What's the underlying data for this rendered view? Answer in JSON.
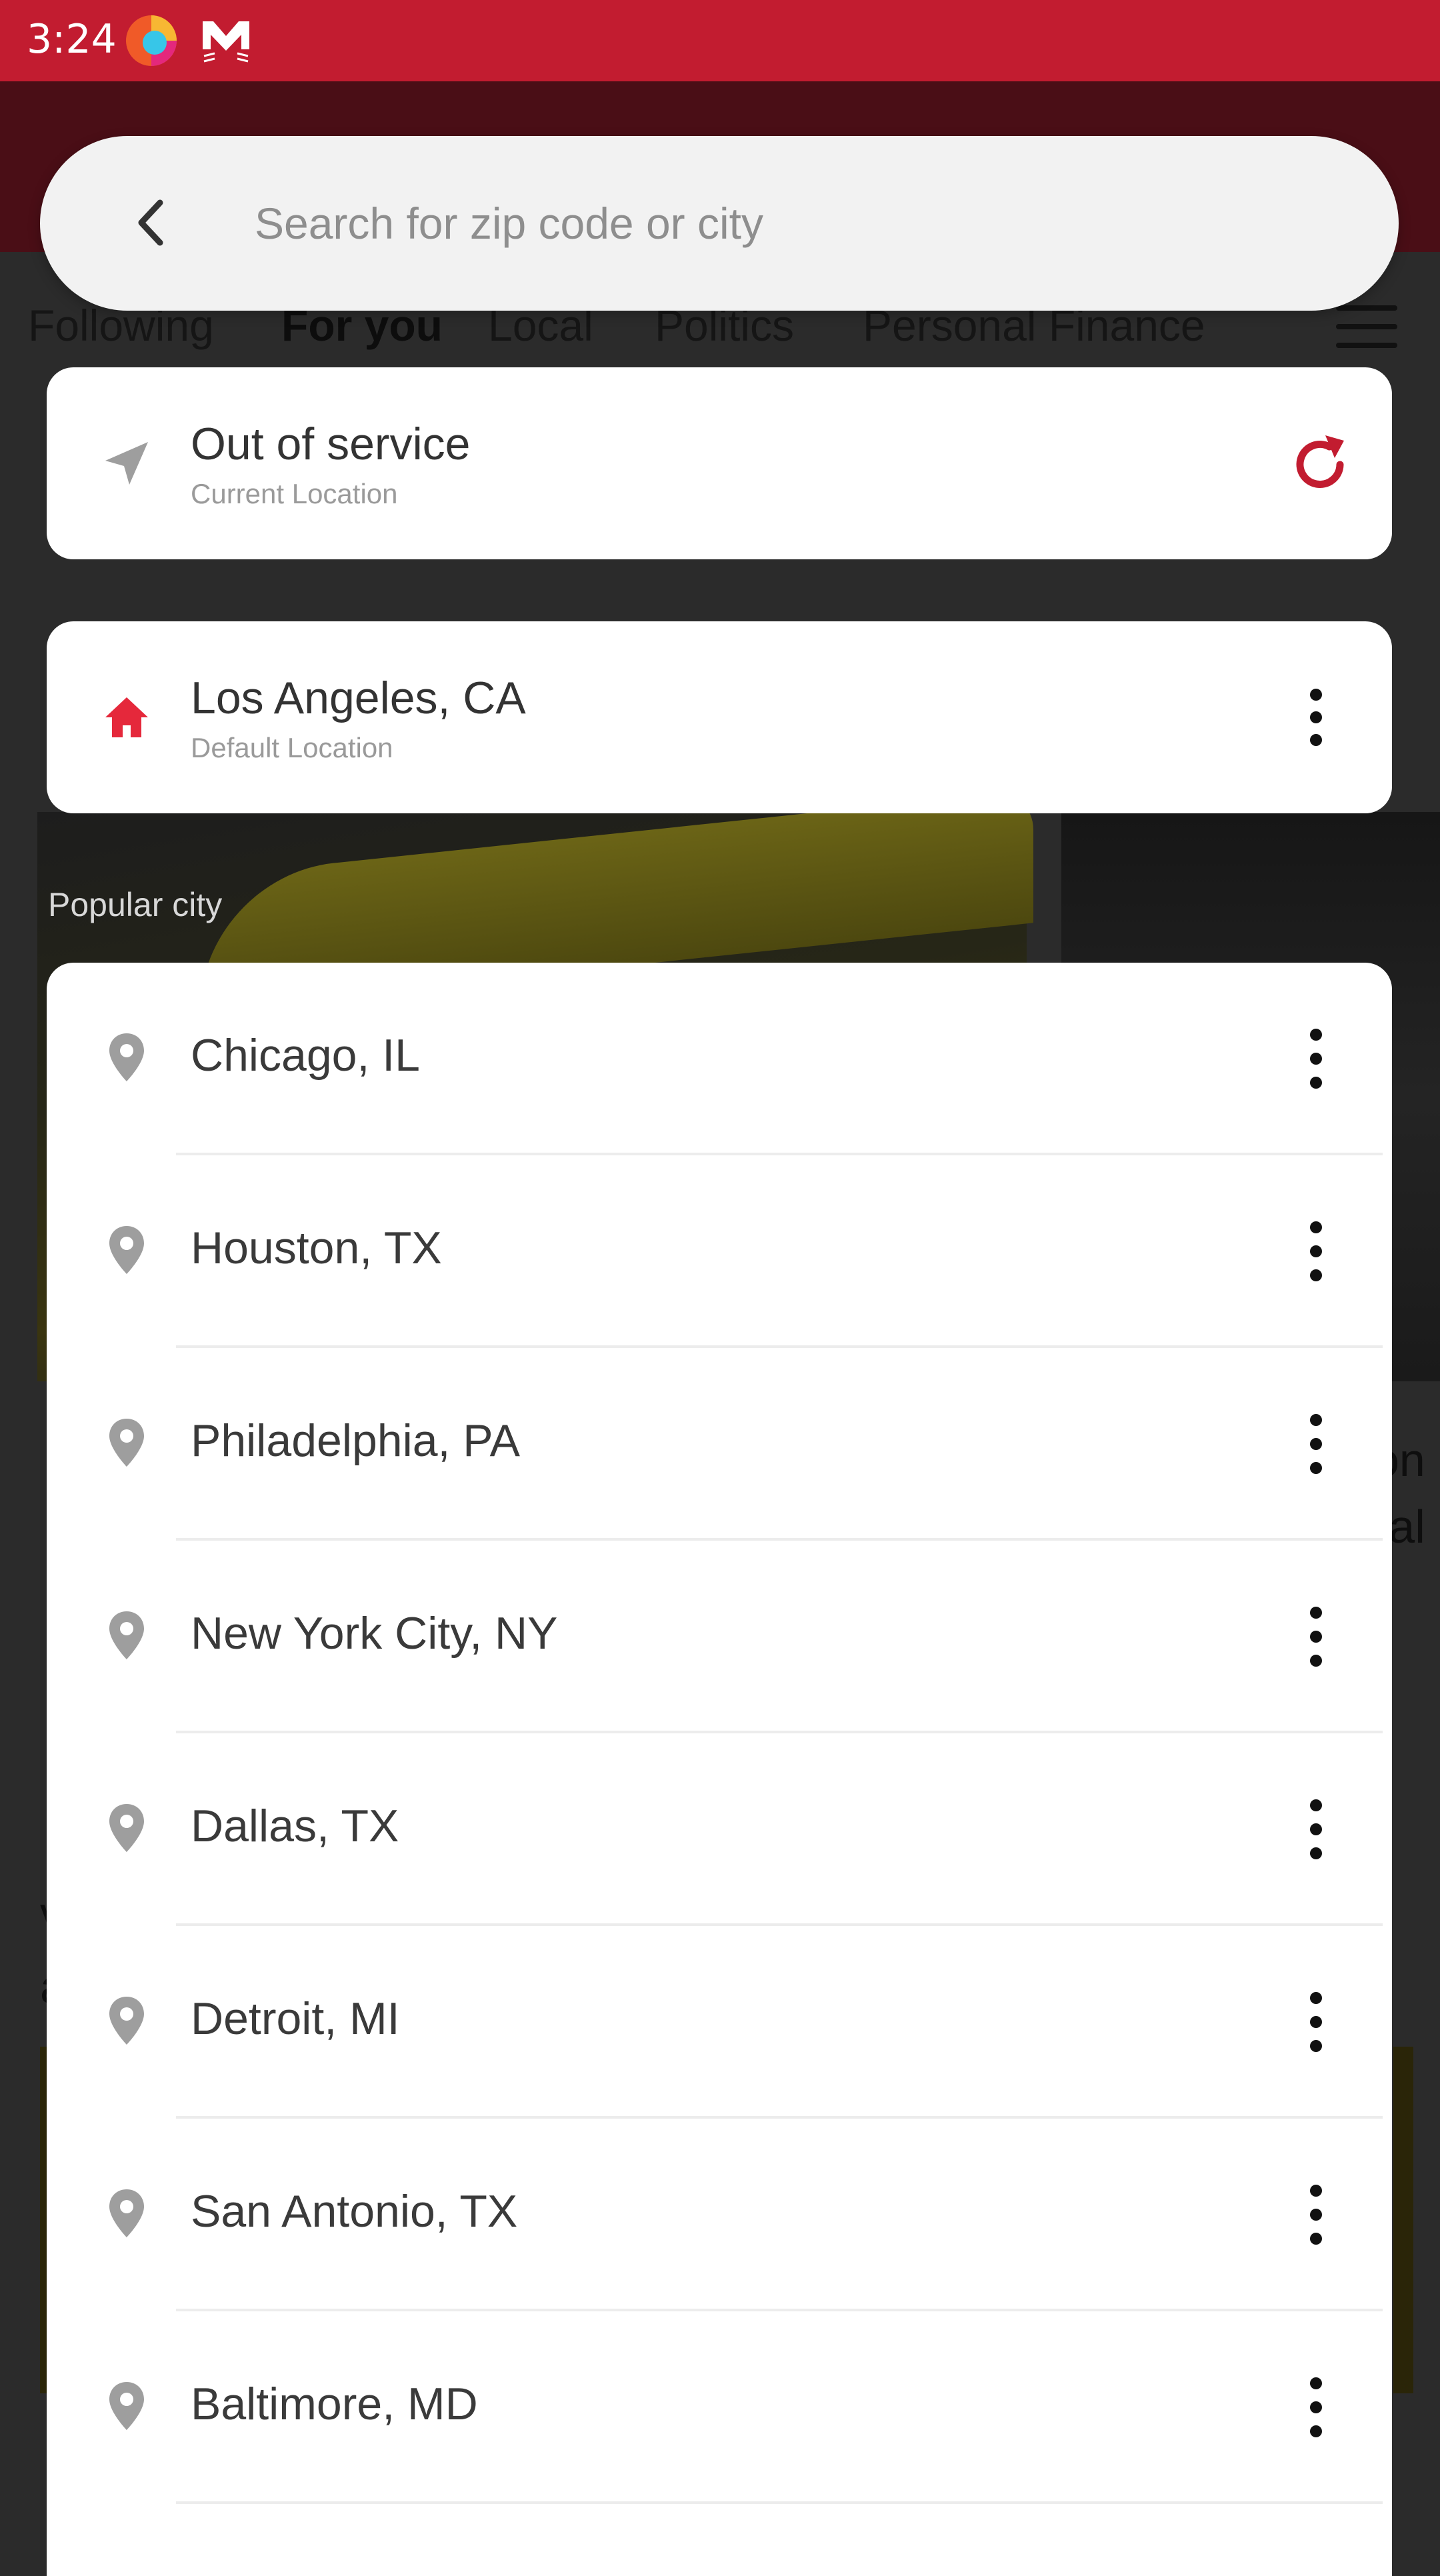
{
  "status_bar": {
    "time": "3:24",
    "icons": [
      "firefox-like-app-icon",
      "mail-cat-icon"
    ]
  },
  "background_tabs": [
    "Following",
    "For you",
    "Local",
    "Politics",
    "Personal Finance"
  ],
  "background_partial_text": [
    "on",
    "ral"
  ],
  "background_letters": [
    "v",
    "a"
  ],
  "search": {
    "placeholder": "Search for zip code or city",
    "value": ""
  },
  "current_location": {
    "title": "Out of service",
    "subtitle": "Current Location"
  },
  "default_location": {
    "title": "Los Angeles, CA",
    "subtitle": "Default Location"
  },
  "popular_label": "Popular city",
  "popular_cities": [
    "Chicago, IL",
    "Houston, TX",
    "Philadelphia, PA",
    "New York City, NY",
    "Dallas, TX",
    "Detroit, MI",
    "San Antonio, TX",
    "Baltimore, MD"
  ],
  "colors": {
    "accent": "#c21c30",
    "home_icon": "#e5283b",
    "pin_icon": "#9e9e9e",
    "nav_icon": "#9e9e9e"
  }
}
